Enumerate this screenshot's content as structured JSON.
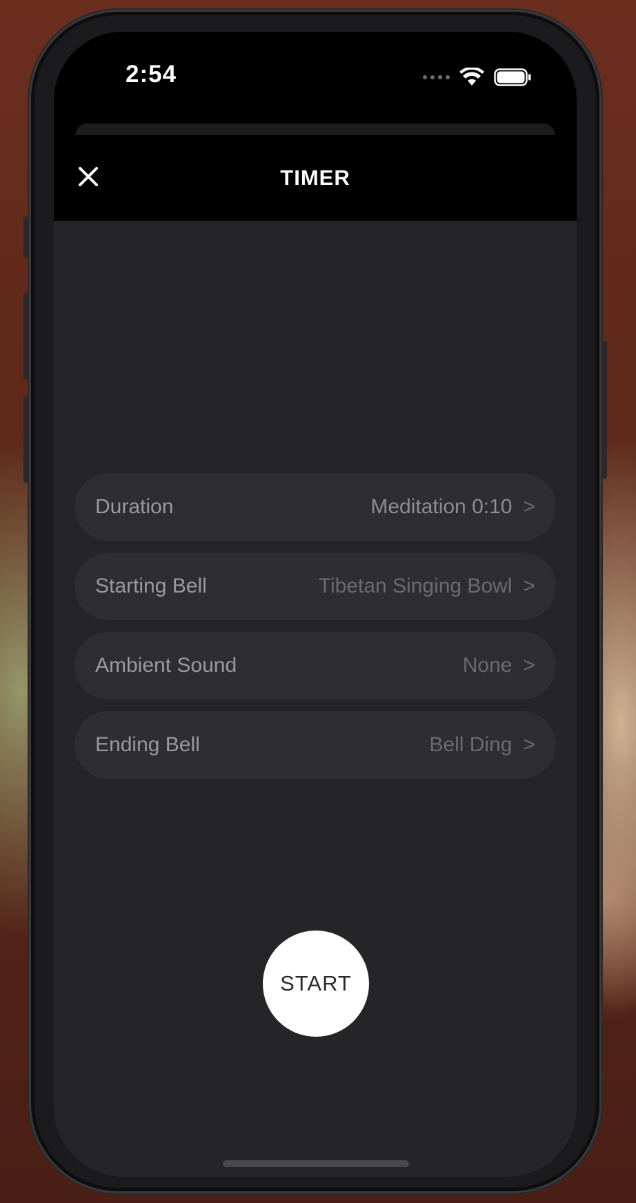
{
  "status_bar": {
    "time": "2:54"
  },
  "nav": {
    "title": "TIMER",
    "close_icon": "close-icon"
  },
  "settings": [
    {
      "label": "Duration",
      "value": "Meditation 0:10",
      "chevron": ">"
    },
    {
      "label": "Starting Bell",
      "value": "Tibetan Singing Bowl",
      "chevron": ">"
    },
    {
      "label": "Ambient Sound",
      "value": "None",
      "chevron": ">"
    },
    {
      "label": "Ending Bell",
      "value": "Bell Ding",
      "chevron": ">"
    }
  ],
  "start_button": {
    "label": "START"
  },
  "colors": {
    "background": "#252427",
    "row": "#2e2d31",
    "nav": "#000000",
    "accent": "#ffffff"
  }
}
